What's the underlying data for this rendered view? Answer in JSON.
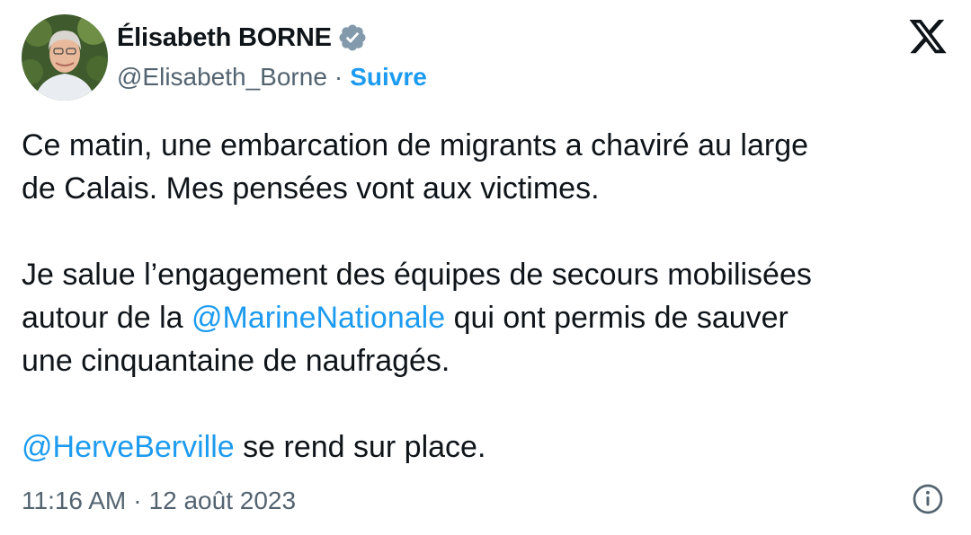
{
  "author": {
    "display_name": "Élisabeth BORNE",
    "handle": "@Elisabeth_Borne",
    "separator": "·",
    "follow_label": "Suivre",
    "verified_color": "#829aab"
  },
  "tweet": {
    "paragraphs": [
      {
        "line1": "Ce matin, une embarcation de migrants a chaviré au large",
        "line2": "de Calais. Mes pensées vont aux victimes."
      },
      {
        "line1": "Je salue l’engagement des équipes de secours mobilisées",
        "line2_before": "autour de la ",
        "mention": "@MarineNationale",
        "line2_after": " qui ont permis de sauver",
        "line3": "une cinquantaine de naufragés."
      },
      {
        "mention": "@HerveBerville",
        "after": " se rend sur place."
      }
    ]
  },
  "footer": {
    "time": "11:16 AM",
    "separator": "·",
    "date": "12 août 2023"
  },
  "icons": {
    "logo": "x-logo-icon",
    "verified": "verified-badge-icon",
    "info": "info-icon"
  },
  "colors": {
    "link": "#1d9bf0",
    "secondary_text": "#536471",
    "primary_text": "#0f1419"
  }
}
